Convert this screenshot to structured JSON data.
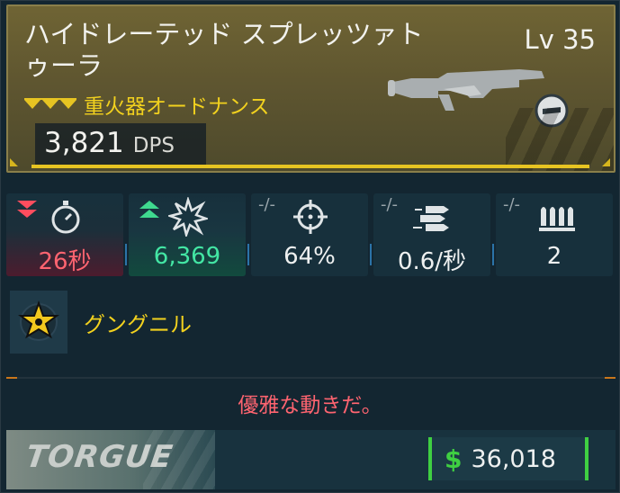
{
  "weapon": {
    "name": "ハイドレーテッド スプレッツァトゥーラ",
    "level": "Lv 35",
    "rarity_label": "重火器オードナンス",
    "dps_value": "3,821",
    "dps_label": "DPS",
    "rarity_color": "#f2d11e"
  },
  "stats": [
    {
      "value": "26秒",
      "trend": "down",
      "icon": "stopwatch-icon",
      "color": "#ff6470"
    },
    {
      "value": "6,369",
      "trend": "up",
      "icon": "explosion-icon",
      "color": "#43e6a4"
    },
    {
      "value": "64%",
      "trend": "neutral",
      "trend_label": "-/-",
      "icon": "crosshair-icon"
    },
    {
      "value": "0.6/秒",
      "trend": "neutral",
      "trend_label": "-/-",
      "icon": "bullets-icon"
    },
    {
      "value": "2",
      "trend": "neutral",
      "trend_label": "-/-",
      "icon": "magazine-icon"
    }
  ],
  "perk": {
    "name": "グングニル",
    "icon": "star-burst-icon"
  },
  "flavor_text": "優雅な動きだ。",
  "footer": {
    "manufacturer": "TORGUE",
    "price": "36,018",
    "currency_icon": "dollar-icon",
    "price_color": "#3fcf42"
  }
}
